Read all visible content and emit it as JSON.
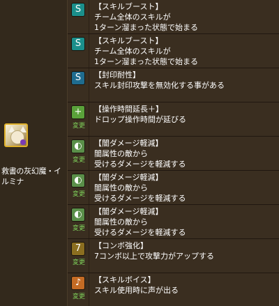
{
  "character": {
    "name_line1": "救書の灰幻魔・イ",
    "name_line2": "ルミナ",
    "icon": "character-portrait"
  },
  "henkou_label": "変更",
  "awakenings": [
    {
      "icon": "skill-boost-icon",
      "title": "【スキルブースト】",
      "line1": "チーム全体のスキルが",
      "line2": "1ターン溜まった状態で始まる",
      "changed": false
    },
    {
      "icon": "skill-boost-icon",
      "title": "【スキルブースト】",
      "line1": "チーム全体のスキルが",
      "line2": "1ターン溜まった状態で始まる",
      "changed": false
    },
    {
      "icon": "skill-seal-resist-icon",
      "title": "【封印耐性】",
      "line1": "スキル封印攻撃を無効化する事がある",
      "line2": "",
      "changed": false
    },
    {
      "icon": "time-extend-plus-icon",
      "title": "【操作時間延長＋】",
      "line1": "ドロップ操作時間が延びる",
      "line2": "",
      "changed": true
    },
    {
      "icon": "dark-reduce-icon",
      "title": "【闇ダメージ軽減】",
      "line1": "闇属性の敵から",
      "line2": "受けるダメージを軽減する",
      "changed": true
    },
    {
      "icon": "dark-reduce-icon",
      "title": "【闇ダメージ軽減】",
      "line1": "闇属性の敵から",
      "line2": "受けるダメージを軽減する",
      "changed": true
    },
    {
      "icon": "dark-reduce-icon",
      "title": "【闇ダメージ軽減】",
      "line1": "闇属性の敵から",
      "line2": "受けるダメージを軽減する",
      "changed": true
    },
    {
      "icon": "combo-boost-icon",
      "title": "【コンボ強化】",
      "line1": "7コンボ以上で攻撃力がアップする",
      "line2": "",
      "changed": true
    },
    {
      "icon": "skill-voice-icon",
      "title": "【スキルボイス】",
      "line1": "スキル使用時に声が出る",
      "line2": "",
      "changed": true
    }
  ]
}
